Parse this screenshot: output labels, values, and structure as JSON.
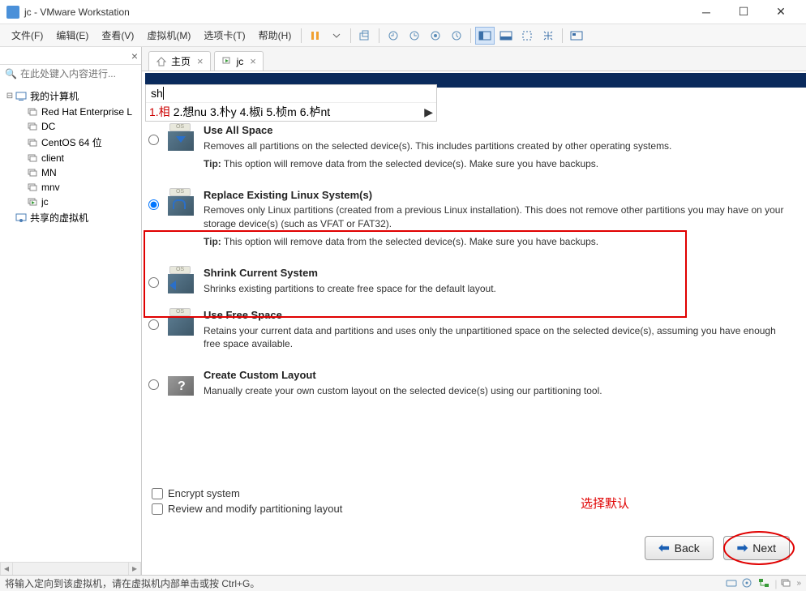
{
  "window": {
    "title": "jc - VMware Workstation"
  },
  "menu": {
    "items": [
      {
        "label": "文件(F)",
        "accel": "F"
      },
      {
        "label": "编辑(E)",
        "accel": "E"
      },
      {
        "label": "查看(V)",
        "accel": "V"
      },
      {
        "label": "虚拟机(M)",
        "accel": "M"
      },
      {
        "label": "选项卡(T)",
        "accel": "T"
      },
      {
        "label": "帮助(H)",
        "accel": "H"
      }
    ]
  },
  "sidebar": {
    "search_placeholder": "在此处键入内容进行...",
    "root": "我的计算机",
    "items": [
      {
        "label": "Red Hat Enterprise L"
      },
      {
        "label": "DC"
      },
      {
        "label": "CentOS 64 位"
      },
      {
        "label": "client"
      },
      {
        "label": "MN"
      },
      {
        "label": "mnv"
      },
      {
        "label": "jc"
      }
    ],
    "shared": "共享的虚拟机"
  },
  "tabs": {
    "home": "主页",
    "vm": "jc"
  },
  "ime": {
    "input": "sh",
    "candidates": [
      "1.相",
      "2.想nu",
      "3.朴y",
      "4.椒i",
      "5.桢m",
      "6.栌nt"
    ]
  },
  "installer": {
    "options": [
      {
        "title": "Use All Space",
        "desc": "Removes all partitions on the selected device(s).  This includes partitions created by other operating systems.",
        "tip": "This option will remove data from the selected device(s).  Make sure you have backups."
      },
      {
        "title": "Replace Existing Linux System(s)",
        "desc": "Removes only Linux partitions (created from a previous Linux installation).  This does not remove other partitions you may have on your storage device(s) (such as VFAT or FAT32).",
        "tip": "This option will remove data from the selected device(s).  Make sure you have backups."
      },
      {
        "title": "Shrink Current System",
        "desc": "Shrinks existing partitions to create free space for the default layout.",
        "tip": ""
      },
      {
        "title": "Use Free Space",
        "desc": "Retains your current data and partitions and uses only the unpartitioned space on the selected device(s), assuming you have enough free space available.",
        "tip": ""
      },
      {
        "title": "Create Custom Layout",
        "desc": "Manually create your own custom layout on the selected device(s) using our partitioning tool.",
        "tip": ""
      }
    ],
    "selected_index": 1,
    "checks": {
      "encrypt": "Encrypt system",
      "review": "Review and modify partitioning layout"
    },
    "annotation": "选择默认",
    "back": "Back",
    "next": "Next",
    "tip_prefix": "Tip:"
  },
  "statusbar": {
    "message": "将输入定向到该虚拟机，请在虚拟机内部单击或按 Ctrl+G。"
  }
}
